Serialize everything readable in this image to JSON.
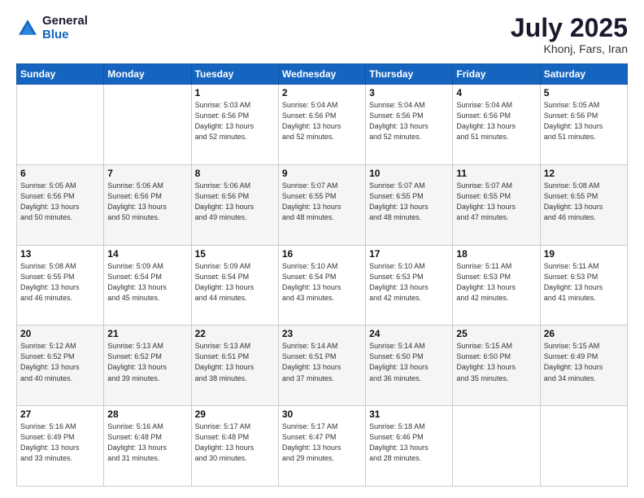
{
  "header": {
    "logo_line1": "General",
    "logo_line2": "Blue",
    "month_year": "July 2025",
    "location": "Khonj, Fars, Iran"
  },
  "weekdays": [
    "Sunday",
    "Monday",
    "Tuesday",
    "Wednesday",
    "Thursday",
    "Friday",
    "Saturday"
  ],
  "weeks": [
    [
      {
        "day": "",
        "info": ""
      },
      {
        "day": "",
        "info": ""
      },
      {
        "day": "1",
        "info": "Sunrise: 5:03 AM\nSunset: 6:56 PM\nDaylight: 13 hours\nand 52 minutes."
      },
      {
        "day": "2",
        "info": "Sunrise: 5:04 AM\nSunset: 6:56 PM\nDaylight: 13 hours\nand 52 minutes."
      },
      {
        "day": "3",
        "info": "Sunrise: 5:04 AM\nSunset: 6:56 PM\nDaylight: 13 hours\nand 52 minutes."
      },
      {
        "day": "4",
        "info": "Sunrise: 5:04 AM\nSunset: 6:56 PM\nDaylight: 13 hours\nand 51 minutes."
      },
      {
        "day": "5",
        "info": "Sunrise: 5:05 AM\nSunset: 6:56 PM\nDaylight: 13 hours\nand 51 minutes."
      }
    ],
    [
      {
        "day": "6",
        "info": "Sunrise: 5:05 AM\nSunset: 6:56 PM\nDaylight: 13 hours\nand 50 minutes."
      },
      {
        "day": "7",
        "info": "Sunrise: 5:06 AM\nSunset: 6:56 PM\nDaylight: 13 hours\nand 50 minutes."
      },
      {
        "day": "8",
        "info": "Sunrise: 5:06 AM\nSunset: 6:56 PM\nDaylight: 13 hours\nand 49 minutes."
      },
      {
        "day": "9",
        "info": "Sunrise: 5:07 AM\nSunset: 6:55 PM\nDaylight: 13 hours\nand 48 minutes."
      },
      {
        "day": "10",
        "info": "Sunrise: 5:07 AM\nSunset: 6:55 PM\nDaylight: 13 hours\nand 48 minutes."
      },
      {
        "day": "11",
        "info": "Sunrise: 5:07 AM\nSunset: 6:55 PM\nDaylight: 13 hours\nand 47 minutes."
      },
      {
        "day": "12",
        "info": "Sunrise: 5:08 AM\nSunset: 6:55 PM\nDaylight: 13 hours\nand 46 minutes."
      }
    ],
    [
      {
        "day": "13",
        "info": "Sunrise: 5:08 AM\nSunset: 6:55 PM\nDaylight: 13 hours\nand 46 minutes."
      },
      {
        "day": "14",
        "info": "Sunrise: 5:09 AM\nSunset: 6:54 PM\nDaylight: 13 hours\nand 45 minutes."
      },
      {
        "day": "15",
        "info": "Sunrise: 5:09 AM\nSunset: 6:54 PM\nDaylight: 13 hours\nand 44 minutes."
      },
      {
        "day": "16",
        "info": "Sunrise: 5:10 AM\nSunset: 6:54 PM\nDaylight: 13 hours\nand 43 minutes."
      },
      {
        "day": "17",
        "info": "Sunrise: 5:10 AM\nSunset: 6:53 PM\nDaylight: 13 hours\nand 42 minutes."
      },
      {
        "day": "18",
        "info": "Sunrise: 5:11 AM\nSunset: 6:53 PM\nDaylight: 13 hours\nand 42 minutes."
      },
      {
        "day": "19",
        "info": "Sunrise: 5:11 AM\nSunset: 6:53 PM\nDaylight: 13 hours\nand 41 minutes."
      }
    ],
    [
      {
        "day": "20",
        "info": "Sunrise: 5:12 AM\nSunset: 6:52 PM\nDaylight: 13 hours\nand 40 minutes."
      },
      {
        "day": "21",
        "info": "Sunrise: 5:13 AM\nSunset: 6:52 PM\nDaylight: 13 hours\nand 39 minutes."
      },
      {
        "day": "22",
        "info": "Sunrise: 5:13 AM\nSunset: 6:51 PM\nDaylight: 13 hours\nand 38 minutes."
      },
      {
        "day": "23",
        "info": "Sunrise: 5:14 AM\nSunset: 6:51 PM\nDaylight: 13 hours\nand 37 minutes."
      },
      {
        "day": "24",
        "info": "Sunrise: 5:14 AM\nSunset: 6:50 PM\nDaylight: 13 hours\nand 36 minutes."
      },
      {
        "day": "25",
        "info": "Sunrise: 5:15 AM\nSunset: 6:50 PM\nDaylight: 13 hours\nand 35 minutes."
      },
      {
        "day": "26",
        "info": "Sunrise: 5:15 AM\nSunset: 6:49 PM\nDaylight: 13 hours\nand 34 minutes."
      }
    ],
    [
      {
        "day": "27",
        "info": "Sunrise: 5:16 AM\nSunset: 6:49 PM\nDaylight: 13 hours\nand 33 minutes."
      },
      {
        "day": "28",
        "info": "Sunrise: 5:16 AM\nSunset: 6:48 PM\nDaylight: 13 hours\nand 31 minutes."
      },
      {
        "day": "29",
        "info": "Sunrise: 5:17 AM\nSunset: 6:48 PM\nDaylight: 13 hours\nand 30 minutes."
      },
      {
        "day": "30",
        "info": "Sunrise: 5:17 AM\nSunset: 6:47 PM\nDaylight: 13 hours\nand 29 minutes."
      },
      {
        "day": "31",
        "info": "Sunrise: 5:18 AM\nSunset: 6:46 PM\nDaylight: 13 hours\nand 28 minutes."
      },
      {
        "day": "",
        "info": ""
      },
      {
        "day": "",
        "info": ""
      }
    ]
  ]
}
